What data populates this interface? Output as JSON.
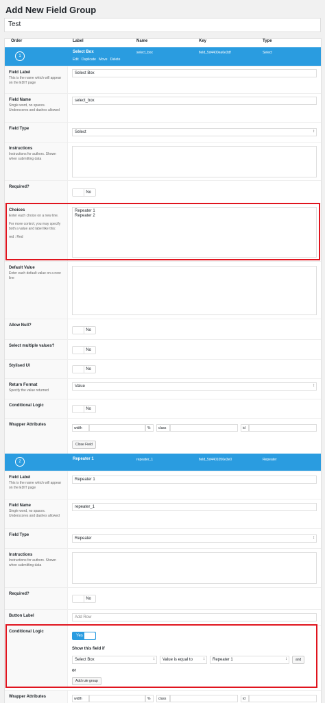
{
  "page": {
    "title": "Add New Field Group",
    "group_title": "Test"
  },
  "columns": {
    "order": "Order",
    "label": "Label",
    "name": "Name",
    "key": "Key",
    "type": "Type"
  },
  "field1": {
    "order": "1",
    "label": "Select Box",
    "name": "select_box",
    "key": "field_5d4400ea6e3df",
    "type": "Select",
    "actions": [
      "Edit",
      "Duplicate",
      "Move",
      "Delete"
    ],
    "field_label": {
      "label": "Field Label",
      "desc": "This is the name which will appear on the EDIT page",
      "value": "Select Box"
    },
    "field_name": {
      "label": "Field Name",
      "desc": "Single word, no spaces. Underscores and dashes allowed",
      "value": "select_box"
    },
    "field_type": {
      "label": "Field Type",
      "value": "Select"
    },
    "instructions": {
      "label": "Instructions",
      "desc": "Instructions for authors. Shown when submitting data"
    },
    "required": {
      "label": "Required?",
      "toggle": "No"
    },
    "choices": {
      "label": "Choices",
      "desc1": "Enter each choice on a new line.",
      "desc2": "For more control, you may specify both a value and label like this:",
      "desc3": "red : Red",
      "line1": "Repeater 1",
      "line2": "Repeater 2"
    },
    "default_value": {
      "label": "Default Value",
      "desc": "Enter each default value on a new line"
    },
    "allow_null": {
      "label": "Allow Null?",
      "toggle": "No"
    },
    "multiple": {
      "label": "Select multiple values?",
      "toggle": "No"
    },
    "stylised": {
      "label": "Stylised UI",
      "toggle": "No"
    },
    "return_format": {
      "label": "Return Format",
      "desc": "Specify the value returned",
      "value": "Value"
    },
    "conditional": {
      "label": "Conditional Logic",
      "toggle": "No"
    },
    "wrapper": {
      "label": "Wrapper Attributes",
      "width": "width",
      "percent": "%",
      "class": "class",
      "id": "id"
    },
    "close_button": "Close Field"
  },
  "field2": {
    "order": "2",
    "label": "Repeater 1",
    "name": "repeater_1",
    "key": "field_5d4401056e3e0",
    "type": "Repeater",
    "field_label": {
      "label": "Field Label",
      "desc": "This is the name which will appear on the EDIT page",
      "value": "Repeater 1"
    },
    "field_name": {
      "label": "Field Name",
      "desc": "Single word, no spaces. Underscores and dashes allowed",
      "value": "repeater_1"
    },
    "field_type": {
      "label": "Field Type",
      "value": "Repeater"
    },
    "instructions": {
      "label": "Instructions",
      "desc": "Instructions for authors. Shown when submitting data"
    },
    "required": {
      "label": "Required?",
      "toggle": "No"
    },
    "button_label": {
      "label": "Button Label",
      "placeholder": "Add Row"
    },
    "conditional": {
      "label": "Conditional Logic",
      "toggle": "Yes",
      "show_if": "Show this field if",
      "field": "Select Box",
      "operator": "Value is equal to",
      "value": "Repeater 1",
      "and": "and",
      "or": "or",
      "add_group": "Add rule group"
    },
    "wrapper": {
      "label": "Wrapper Attributes",
      "width": "width",
      "percent": "%",
      "class": "class",
      "id": "id"
    }
  },
  "colors": {
    "accent": "#2a9ce0",
    "highlight": "#e0141e"
  }
}
